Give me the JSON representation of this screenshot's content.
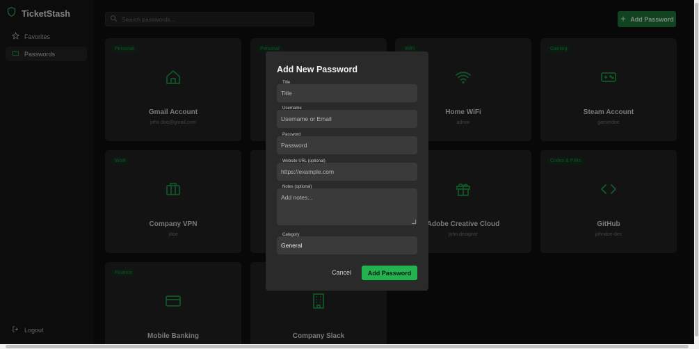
{
  "app": {
    "name": "TicketStash"
  },
  "sidebar": {
    "items": [
      {
        "label": "Favorites",
        "icon": "star-icon"
      },
      {
        "label": "Passwords",
        "icon": "folder-icon",
        "active": true
      }
    ],
    "logout_label": "Logout"
  },
  "search": {
    "placeholder": "Search passwords..."
  },
  "header": {
    "add_button_label": "Add Password"
  },
  "cards": [
    {
      "category": "Personal",
      "title": "Gmail Account",
      "subtitle": "john.doe@gmail.com",
      "icon": "home-icon"
    },
    {
      "category": "Personal",
      "title": "",
      "subtitle": "",
      "icon": ""
    },
    {
      "category": "WiFi",
      "title": "Home WiFi",
      "subtitle": "admin",
      "icon": "wifi-icon"
    },
    {
      "category": "Gaming",
      "title": "Steam Account",
      "subtitle": "gamerdoe",
      "icon": "gamepad-icon"
    },
    {
      "category": "Work",
      "title": "Company VPN",
      "subtitle": "jdoe",
      "icon": "briefcase-icon"
    },
    {
      "category": "",
      "title": "",
      "subtitle": "",
      "icon": ""
    },
    {
      "category": "",
      "title": "Adobe Creative Cloud",
      "subtitle": "john.designer",
      "icon": "gift-icon"
    },
    {
      "category": "Codes & PINs",
      "title": "GitHub",
      "subtitle": "johndoe-dev",
      "icon": "code-icon"
    },
    {
      "category": "Finance",
      "title": "Mobile Banking",
      "subtitle": "",
      "icon": "credit-card-icon"
    },
    {
      "category": "",
      "title": "Company Slack",
      "subtitle": "",
      "icon": "building-icon"
    }
  ],
  "modal": {
    "title": "Add New Password",
    "fields": {
      "title": {
        "label": "Title",
        "placeholder": "Title"
      },
      "username": {
        "label": "Username",
        "placeholder": "Username or Email"
      },
      "password": {
        "label": "Password",
        "placeholder": "Password"
      },
      "url": {
        "label": "Website URL (optional)",
        "placeholder": "https://example.com"
      },
      "notes": {
        "label": "Notes (optional)",
        "placeholder": "Add notes..."
      },
      "category": {
        "label": "Category",
        "value": "General"
      }
    },
    "cancel_label": "Cancel",
    "submit_label": "Add Password"
  },
  "colors": {
    "accent": "#22b34f",
    "accent_dark": "#1e7a3a",
    "badge_text": "#1f9a47"
  }
}
